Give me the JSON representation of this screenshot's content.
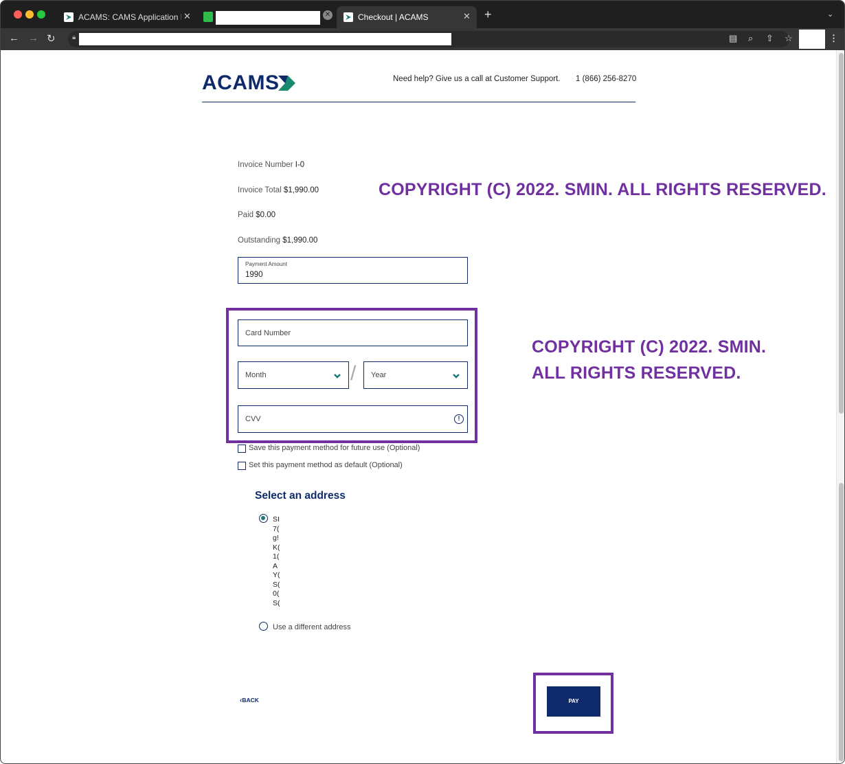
{
  "browser": {
    "tabs": [
      {
        "title": "ACAMS: CAMS Application For"
      },
      {
        "title": ""
      },
      {
        "title": "Checkout | ACAMS"
      }
    ]
  },
  "header": {
    "logo_text": "ACAMS",
    "help_text": "Need help? Give us a call at Customer Support.",
    "phone": "1 (866) 256-8270"
  },
  "invoice": {
    "number_label": "Invoice Number",
    "number_value": "I-0",
    "total_label": "Invoice Total",
    "total_value": "$1,990.00",
    "paid_label": "Paid",
    "paid_value": "$0.00",
    "outstanding_label": "Outstanding",
    "outstanding_value": "$1,990.00"
  },
  "payment": {
    "amount_label": "Payment Amount",
    "amount_value": "1990",
    "card_number_placeholder": "Card Number",
    "month_placeholder": "Month",
    "year_placeholder": "Year",
    "cvv_placeholder": "CVV",
    "save_method_label": "Save this payment method for future use (Optional)",
    "default_method_label": "Set this payment method as default (Optional)"
  },
  "address": {
    "title": "Select an address",
    "lines": [
      "SI",
      "7(",
      "g!",
      "K(",
      "1(",
      "A",
      "Y(",
      "S(",
      "0(",
      "S("
    ],
    "different_label": "Use a different address"
  },
  "actions": {
    "back_label": "BACK",
    "pay_label": "PAY"
  },
  "watermark": {
    "line1": "COPYRIGHT (C) 2022. SMIN. ALL RIGHTS RESERVED.",
    "line2a": "COPYRIGHT (C) 2022. SMIN.",
    "line2b": "ALL RIGHTS RESERVED."
  },
  "colors": {
    "brand_navy": "#0f2a6b",
    "accent_teal": "#1a7a76",
    "highlight_purple": "#7030a0"
  }
}
